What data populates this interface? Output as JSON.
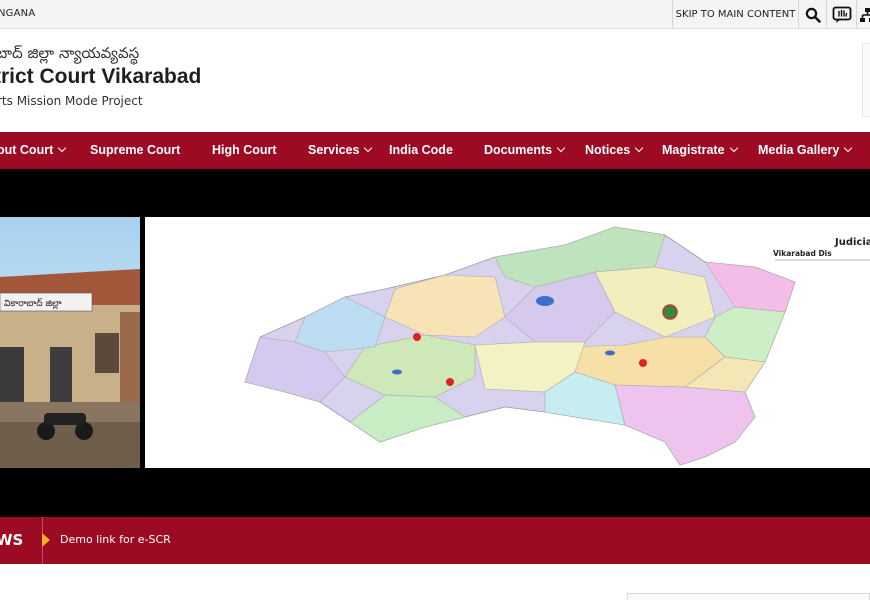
{
  "topbar": {
    "state": "NGANA",
    "skip_link": "SKIP TO MAIN CONTENT",
    "icons": [
      "search-icon",
      "sign-language-icon",
      "sitemap-icon"
    ]
  },
  "header": {
    "telugu_title": "బాద్ జిల్లా న్యాయవ్యవస్థ",
    "title": "trict Court Vikarabad",
    "subtitle": "rts Mission Mode Project"
  },
  "nav": {
    "items": [
      {
        "label": "out Court",
        "dropdown": true
      },
      {
        "label": "Supreme Court",
        "dropdown": false
      },
      {
        "label": "High Court",
        "dropdown": false
      },
      {
        "label": "Services",
        "dropdown": true
      },
      {
        "label": "India Code",
        "dropdown": false
      },
      {
        "label": "Documents",
        "dropdown": true
      },
      {
        "label": "Notices",
        "dropdown": true
      },
      {
        "label": "Magistrate",
        "dropdown": true
      },
      {
        "label": "Media Gallery",
        "dropdown": true
      }
    ]
  },
  "banner": {
    "photo_sign": "వికారాబాద్ జిల్లా",
    "map_title": "Judicial",
    "map_subtitle": "Vikarabad Dis"
  },
  "news": {
    "label": "WS",
    "item": "Demo link for e-SCR"
  },
  "colors": {
    "brand": "#9c0b23",
    "accent": "#f0b323",
    "banner_bg": "#000000"
  }
}
